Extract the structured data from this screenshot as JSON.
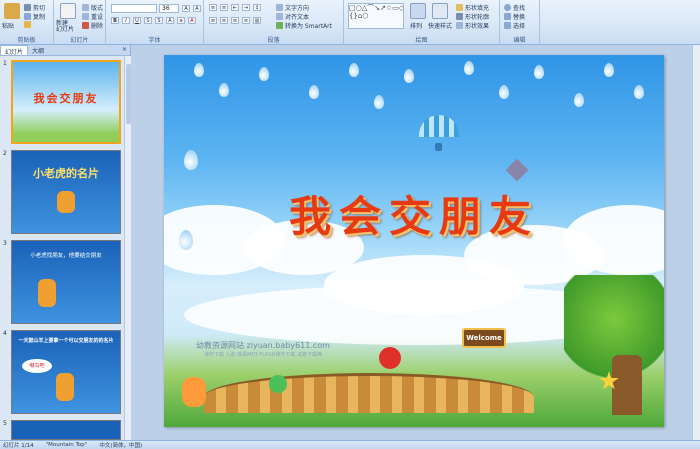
{
  "ribbon": {
    "clipboard": {
      "label": "剪贴板",
      "paste": "粘贴",
      "cut": "剪切",
      "copy": "复制",
      "format_painter": "格式刷"
    },
    "slides": {
      "label": "幻灯片",
      "new_slide": "新建\n幻灯片",
      "layout": "版式",
      "reset": "重设",
      "delete": "删除"
    },
    "font": {
      "label": "字体",
      "font_size": "36"
    },
    "paragraph": {
      "label": "段落",
      "text_direction": "文字方向",
      "align_text": "对齐文本",
      "smartart": "转换为 SmartArt"
    },
    "drawing": {
      "label": "绘图",
      "arrange": "排列",
      "quick_styles": "快速样式",
      "shape_fill": "形状填充",
      "shape_outline": "形状轮廓",
      "shape_effects": "形状效果"
    },
    "editing": {
      "label": "编辑",
      "find": "查找",
      "replace": "替换",
      "select": "选择"
    }
  },
  "panel": {
    "tab_slides": "幻灯片",
    "tab_outline": "大纲",
    "close": "×",
    "thumbnails": [
      {
        "num": "1",
        "title": "我会交朋友"
      },
      {
        "num": "2",
        "title": "小老虎的名片"
      },
      {
        "num": "3",
        "title": "小老虎找朋友，他要结交朋友"
      },
      {
        "num": "4",
        "title": "一天鼓山羊上要拿一个可以交朋友的的名片",
        "bubble": "嘟鸟吧"
      },
      {
        "num": "5",
        "title": ""
      }
    ]
  },
  "slide": {
    "title": "我会交朋友",
    "watermark": "幼教资源网站 ziyuan.baby611.com",
    "watermark_sub": "课件下载 儿歌 故事MP3 FLASH课件下载 试卷下载等",
    "welcome_sign": "Welcome"
  },
  "status": {
    "slide_counter": "幻灯片 1/14",
    "theme": "\"Mountain Top\"",
    "language": "中文(简体，中国)"
  },
  "colors": {
    "title_red": "#e83a12",
    "ribbon_bg": "#dbe8f7",
    "selection_orange": "#f2a51c"
  }
}
